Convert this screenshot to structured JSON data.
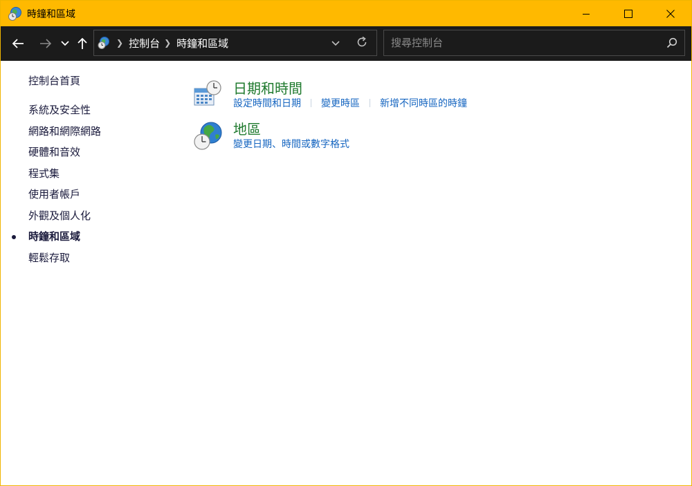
{
  "window": {
    "title": "時鐘和區域",
    "accent_color": "#ffb900",
    "controls": {
      "minimize_icon": "minimize-icon",
      "maximize_icon": "maximize-icon",
      "close_icon": "close-icon"
    }
  },
  "nav": {
    "back_icon": "back-arrow-icon",
    "forward_icon": "forward-arrow-icon",
    "recent_icon": "chevron-down-icon",
    "up_icon": "up-arrow-icon",
    "breadcrumb": [
      "控制台",
      "時鐘和區域"
    ],
    "refresh_icon": "refresh-icon",
    "search_placeholder": "搜尋控制台"
  },
  "sidebar": {
    "home": "控制台首頁",
    "items": [
      {
        "label": "系統及安全性",
        "active": false
      },
      {
        "label": "網路和網際網路",
        "active": false
      },
      {
        "label": "硬體和音效",
        "active": false
      },
      {
        "label": "程式集",
        "active": false
      },
      {
        "label": "使用者帳戶",
        "active": false
      },
      {
        "label": "外觀及個人化",
        "active": false
      },
      {
        "label": "時鐘和區域",
        "active": true
      },
      {
        "label": "輕鬆存取",
        "active": false
      }
    ]
  },
  "categories": [
    {
      "title": "日期和時間",
      "icon": "calendar-clock-icon",
      "links": [
        "設定時間和日期",
        "變更時區",
        "新增不同時區的時鐘"
      ]
    },
    {
      "title": "地區",
      "icon": "globe-clock-icon",
      "links": [
        "變更日期、時間或數字格式"
      ]
    }
  ],
  "colors": {
    "link": "#1565c0",
    "category_title": "#1f7a2e",
    "nav_bg": "#1b1b1b"
  }
}
